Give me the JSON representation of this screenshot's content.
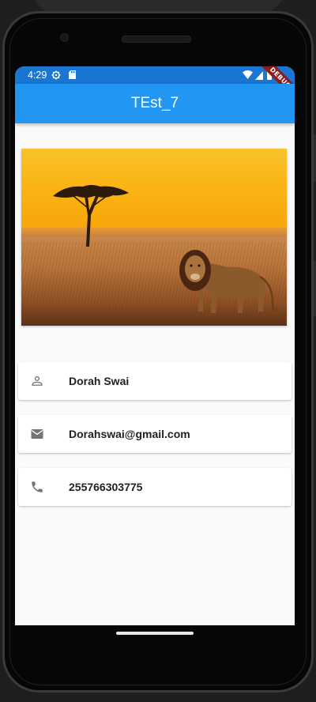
{
  "status_bar": {
    "time": "4:29",
    "icons": [
      "settings-gear-icon",
      "sd-card-icon",
      "wifi-icon",
      "signal-icon",
      "battery-icon"
    ],
    "debug_banner": "DEBUG",
    "color": "#1976d2"
  },
  "app_bar": {
    "title": "TEst_7",
    "color": "#2196f3"
  },
  "photo": {
    "subject": "lion-savanna-sunset-image"
  },
  "profile": {
    "name": {
      "icon": "person-icon",
      "text": "Dorah Swai"
    },
    "email": {
      "icon": "mail-icon",
      "text": "Dorahswai@gmail.com"
    },
    "phone": {
      "icon": "phone-icon",
      "text": "255766303775"
    }
  }
}
